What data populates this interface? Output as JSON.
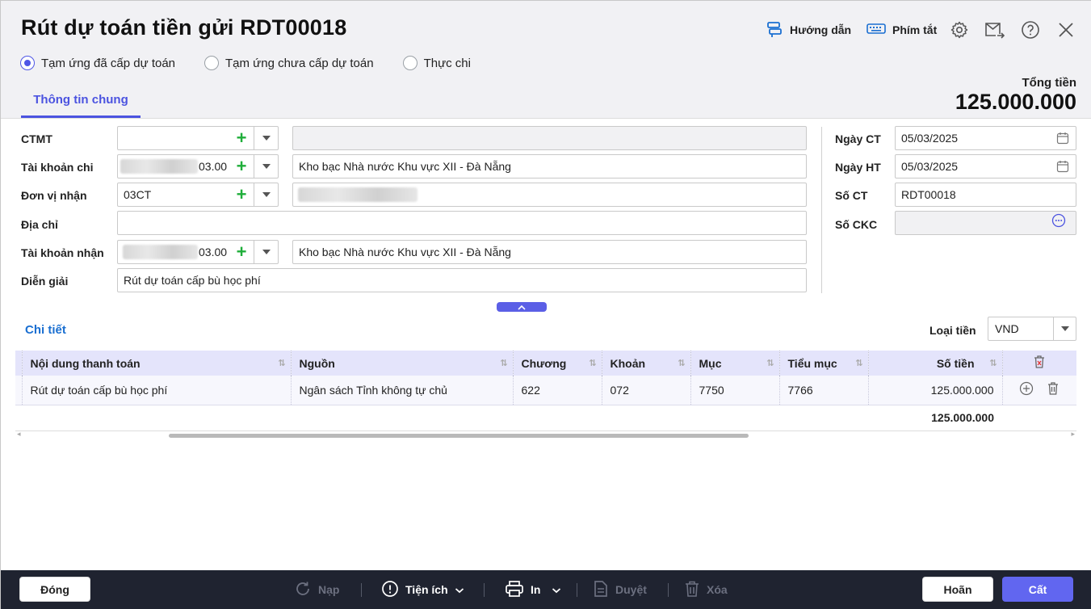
{
  "window": {
    "title": "Rút dự toán tiền gửi RDT00018"
  },
  "header": {
    "guide_label": "Hướng dẫn",
    "shortcut_label": "Phím tắt",
    "icons": [
      "signpost-icon",
      "keyboard-icon",
      "gear-icon",
      "mail-forward-icon",
      "help-icon",
      "close-icon"
    ]
  },
  "radios": [
    {
      "label": "Tạm ứng đã cấp dự toán",
      "selected": true
    },
    {
      "label": "Tạm ứng chưa cấp dự toán",
      "selected": false
    },
    {
      "label": "Thực chi",
      "selected": false
    }
  ],
  "tabs": {
    "general": "Thông tin chung"
  },
  "total": {
    "label": "Tổng tiền",
    "value": "125.000.000"
  },
  "form": {
    "ctmt": {
      "label": "CTMT",
      "value": "",
      "name": ""
    },
    "paying_account": {
      "label": "Tài khoản chi",
      "value_suffix": "03.00",
      "bank": "Kho bạc Nhà nước Khu vực XII - Đà Nẵng"
    },
    "receiver_unit": {
      "label": "Đơn vị nhận",
      "value": "03CT"
    },
    "address": {
      "label": "Địa chỉ",
      "value": ""
    },
    "receiving_account": {
      "label": "Tài khoản nhận",
      "value_suffix": "03.00",
      "bank": "Kho bạc Nhà nước Khu vực XII - Đà Nẵng"
    },
    "description": {
      "label": "Diễn giải",
      "value": "Rút dự toán cấp bù học phí"
    },
    "doc_date": {
      "label": "Ngày CT",
      "value": "05/03/2025"
    },
    "post_date": {
      "label": "Ngày HT",
      "value": "05/03/2025"
    },
    "doc_no": {
      "label": "Số CT",
      "value": "RDT00018"
    },
    "ckc_no": {
      "label": "Số CKC",
      "value": ""
    }
  },
  "detail": {
    "title": "Chi tiết",
    "currency_label": "Loại tiền",
    "currency_value": "VND",
    "columns": [
      "Nội dung thanh toán",
      "Nguồn",
      "Chương",
      "Khoản",
      "Mục",
      "Tiểu mục",
      "Số tiền"
    ],
    "rows": [
      [
        "Rút dự toán cấp bù học phí",
        "Ngân sách Tỉnh không tự chủ",
        "622",
        "072",
        "7750",
        "7766",
        "125.000.000"
      ]
    ],
    "sum": "125.000.000"
  },
  "footer": {
    "close": "Đóng",
    "reload": "Nạp",
    "utility": "Tiện ích",
    "print": "In",
    "approve": "Duyệt",
    "delete": "Xóa",
    "cancel": "Hoãn",
    "save": "Cất"
  },
  "colors": {
    "accent": "#4b53e0",
    "link": "#1a6fd1",
    "footer_bg": "#1f2330",
    "save_btn": "#6166f0",
    "plus_green": "#1fae3a"
  }
}
